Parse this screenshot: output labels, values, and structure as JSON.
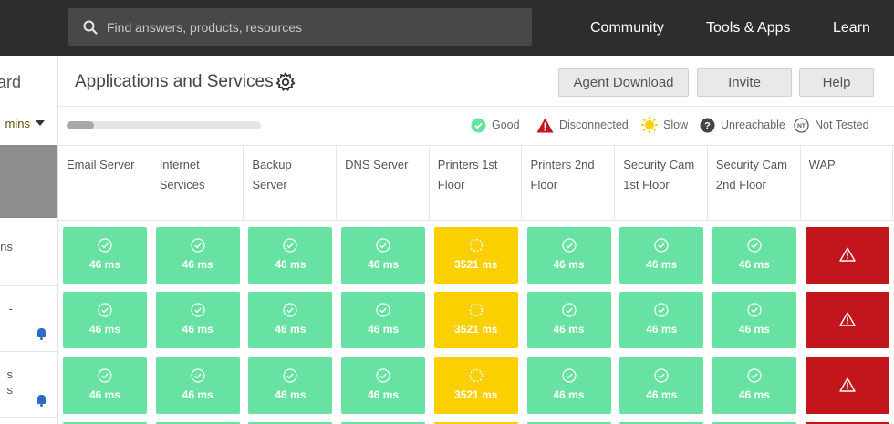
{
  "topbar": {
    "search_placeholder": "Find answers, products, resources",
    "nav": [
      "Community",
      "Tools & Apps",
      "Learn"
    ]
  },
  "sidebar": {
    "title_fragment": "ard",
    "select_fragment": "mins",
    "rows": [
      {
        "lines": [
          "ns"
        ],
        "bell": false
      },
      {
        "lines": [
          "-",
          ""
        ],
        "bell": true
      },
      {
        "lines": [
          "s",
          "s"
        ],
        "bell": true
      }
    ]
  },
  "header": {
    "title": "Applications and Services",
    "buttons": {
      "agent_download": "Agent Download",
      "invite": "Invite",
      "help": "Help"
    }
  },
  "progress": {
    "value_fraction": 0.14
  },
  "legend": {
    "good": "Good",
    "disconnected": "Disconnected",
    "slow": "Slow",
    "unreachable": "Unreachable",
    "not_tested": "Not Tested",
    "not_tested_badge": "NT"
  },
  "colors": {
    "good": "#67e2a2",
    "slow": "#fcd000",
    "disconnected": "#c3161c",
    "unreachable": "#444444"
  },
  "columns": [
    "Email Server",
    "Internet Services",
    "Backup Server",
    "DNS Server",
    "Printers 1st Floor",
    "Printers 2nd Floor",
    "Security Cam 1st Floor",
    "Security Cam 2nd Floor",
    "WAP"
  ],
  "rows": [
    {
      "cells": [
        {
          "status": "good",
          "latency": "46 ms"
        },
        {
          "status": "good",
          "latency": "46 ms"
        },
        {
          "status": "good",
          "latency": "46 ms"
        },
        {
          "status": "good",
          "latency": "46 ms"
        },
        {
          "status": "slow",
          "latency": "3521 ms"
        },
        {
          "status": "good",
          "latency": "46 ms"
        },
        {
          "status": "good",
          "latency": "46 ms"
        },
        {
          "status": "good",
          "latency": "46 ms"
        },
        {
          "status": "down",
          "latency": ""
        }
      ]
    },
    {
      "cells": [
        {
          "status": "good",
          "latency": "46 ms"
        },
        {
          "status": "good",
          "latency": "46 ms"
        },
        {
          "status": "good",
          "latency": "46 ms"
        },
        {
          "status": "good",
          "latency": "46 ms"
        },
        {
          "status": "slow",
          "latency": "3521 ms"
        },
        {
          "status": "good",
          "latency": "46 ms"
        },
        {
          "status": "good",
          "latency": "46 ms"
        },
        {
          "status": "good",
          "latency": "46 ms"
        },
        {
          "status": "down",
          "latency": ""
        }
      ]
    },
    {
      "cells": [
        {
          "status": "good",
          "latency": "46 ms"
        },
        {
          "status": "good",
          "latency": "46 ms"
        },
        {
          "status": "good",
          "latency": "46 ms"
        },
        {
          "status": "good",
          "latency": "46 ms"
        },
        {
          "status": "slow",
          "latency": "3521 ms"
        },
        {
          "status": "good",
          "latency": "46 ms"
        },
        {
          "status": "good",
          "latency": "46 ms"
        },
        {
          "status": "good",
          "latency": "46 ms"
        },
        {
          "status": "down",
          "latency": ""
        }
      ]
    }
  ]
}
